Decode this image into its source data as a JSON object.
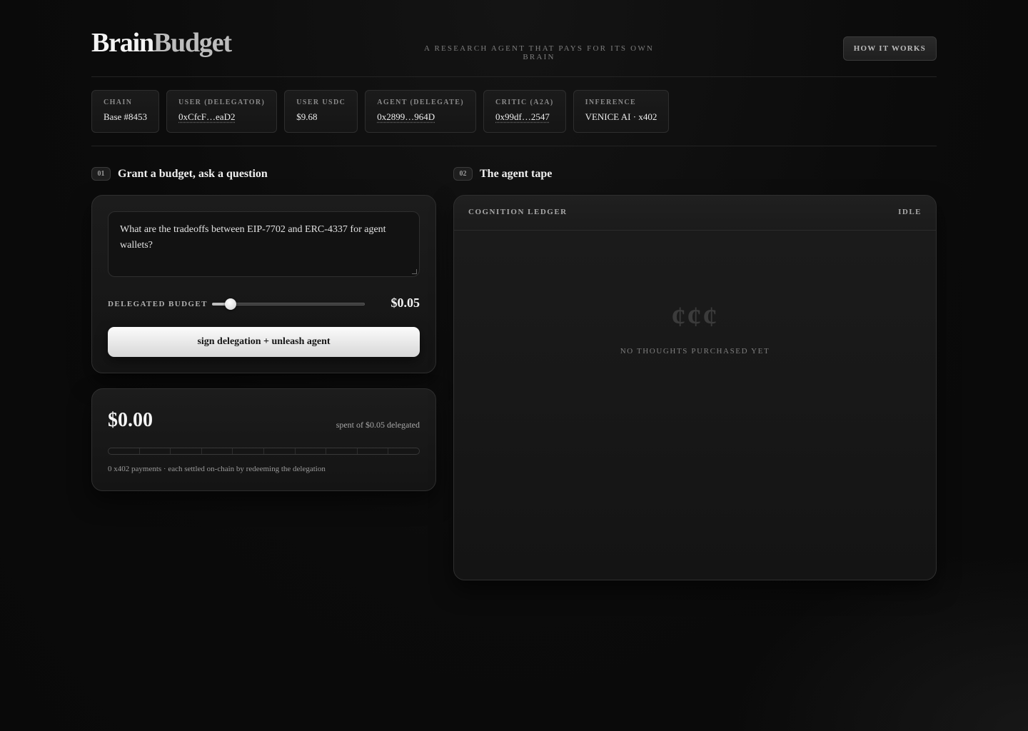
{
  "header": {
    "logo_part1": "Brain",
    "logo_part2": "Budget",
    "tagline": "A RESEARCH AGENT THAT PAYS FOR ITS OWN BRAIN",
    "how_it_works": "HOW IT WORKS"
  },
  "info_cards": [
    {
      "label": "CHAIN",
      "value": "Base #8453"
    },
    {
      "label": "USER (DELEGATOR)",
      "value": "0xCfcF…eaD2"
    },
    {
      "label": "USER USDC",
      "value": "$9.68"
    },
    {
      "label": "AGENT (DELEGATE)",
      "value": "0x2899…964D"
    },
    {
      "label": "CRITIC (A2A)",
      "value": "0x99df…2547"
    },
    {
      "label": "INFERENCE",
      "value": "VENICE AI · x402"
    }
  ],
  "section1": {
    "number": "01",
    "title": "Grant a budget, ask a question",
    "question": "What are the tradeoffs between EIP-7702 and ERC-4337 for agent wallets?",
    "budget_label": "DELEGATED BUDGET",
    "budget_value": "$0.05",
    "budget_slider_fraction": 0.09,
    "cta": "sign delegation + unleash agent"
  },
  "spend": {
    "spent": "$0.00",
    "of_text": "spent of $0.05 delegated",
    "payments_text": "0 x402 payments · each settled on-chain by redeeming the delegation",
    "meter_segments": 10,
    "meter_fill": 0
  },
  "section2": {
    "number": "02",
    "title": "The agent tape",
    "ledger_title": "COGNITION LEDGER",
    "status": "IDLE",
    "empty_glyphs": "¢¢¢",
    "empty_message": "NO THOUGHTS PURCHASED YET"
  }
}
